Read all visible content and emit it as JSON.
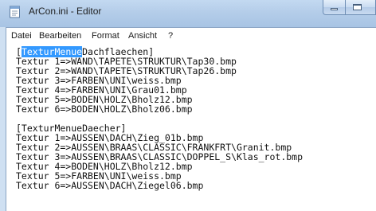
{
  "window": {
    "title": "ArCon.ini - Editor",
    "title_color": "#1e1e1e",
    "frame_color": "#b4cde9",
    "selection_color": "#3399ff"
  },
  "icons": {
    "app": "notepad-icon",
    "minimize": "minimize-icon",
    "maximize": "maximize-icon"
  },
  "menu": {
    "items": [
      "Datei",
      "Bearbeiten",
      "Format",
      "Ansicht",
      "?"
    ]
  },
  "editor": {
    "selection_prefix": "[",
    "selected_text": "TexturMenue",
    "selection_suffix": "Dachflaechen]",
    "lines": [
      "",
      "Textur 1=>WAND\\TAPETE\\STRUKTUR\\Tap30.bmp",
      "Textur 2=>WAND\\TAPETE\\STRUKTUR\\Tap26.bmp",
      "Textur 3=>FARBEN\\UNI\\weiss.bmp",
      "Textur 4=>FARBEN\\UNI\\Grau01.bmp",
      "Textur 5=>BODEN\\HOLZ\\Bholz12.bmp",
      "Textur 6=>BODEN\\HOLZ\\Bholz06.bmp",
      "",
      "[TexturMenueDaecher]",
      "Textur 1=>AUSSEN\\DACH\\Zieg_01b.bmp",
      "Textur 2=>AUSSEN\\BRAAS\\CLASSIC\\FRANKFRT\\Granit.bmp",
      "Textur 3=>AUSSEN\\BRAAS\\CLASSIC\\DOPPEL_S\\Klas_rot.bmp",
      "Textur 4=>BODEN\\HOLZ\\Bholz12.bmp",
      "Textur 5=>FARBEN\\UNI\\weiss.bmp",
      "Textur 6=>AUSSEN\\DACH\\Ziegel06.bmp"
    ]
  }
}
